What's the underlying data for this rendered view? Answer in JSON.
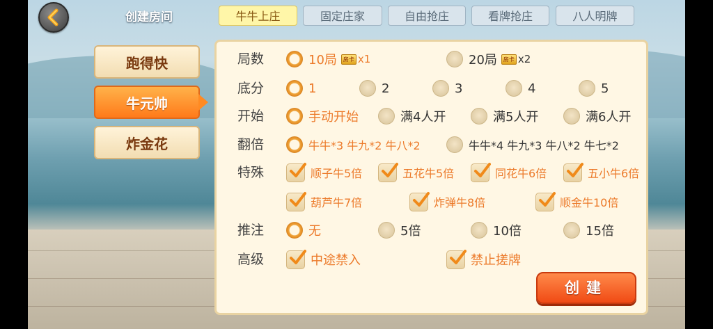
{
  "header": {
    "title": "创建房间",
    "tabs": [
      {
        "label": "牛牛上庄",
        "active": true
      },
      {
        "label": "固定庄家",
        "active": false
      },
      {
        "label": "自由抢庄",
        "active": false
      },
      {
        "label": "看牌抢庄",
        "active": false
      },
      {
        "label": "八人明牌",
        "active": false
      }
    ]
  },
  "sidebar": {
    "items": [
      {
        "label": "跑得快",
        "active": false
      },
      {
        "label": "牛元帅",
        "active": true
      },
      {
        "label": "炸金花",
        "active": false
      }
    ]
  },
  "settings": {
    "rounds": {
      "label": "局数",
      "options": [
        {
          "text": "10局",
          "card": "房卡",
          "mult": "x1",
          "selected": true
        },
        {
          "text": "20局",
          "card": "房卡",
          "mult": "x2",
          "selected": false
        }
      ]
    },
    "base": {
      "label": "底分",
      "options": [
        {
          "text": "1",
          "selected": true
        },
        {
          "text": "2",
          "selected": false
        },
        {
          "text": "3",
          "selected": false
        },
        {
          "text": "4",
          "selected": false
        },
        {
          "text": "5",
          "selected": false
        }
      ]
    },
    "start": {
      "label": "开始",
      "options": [
        {
          "text": "手动开始",
          "selected": true
        },
        {
          "text": "满4人开",
          "selected": false
        },
        {
          "text": "满5人开",
          "selected": false
        },
        {
          "text": "满6人开",
          "selected": false
        }
      ]
    },
    "double": {
      "label": "翻倍",
      "options": [
        {
          "text": "牛牛*3 牛九*2 牛八*2",
          "selected": true
        },
        {
          "text": "牛牛*4 牛九*3 牛八*2 牛七*2",
          "selected": false
        }
      ]
    },
    "special": {
      "label": "特殊",
      "options": [
        {
          "text": "顺子牛5倍",
          "checked": true
        },
        {
          "text": "五花牛5倍",
          "checked": true
        },
        {
          "text": "同花牛6倍",
          "checked": true
        },
        {
          "text": "五小牛6倍",
          "checked": true
        },
        {
          "text": "葫芦牛7倍",
          "checked": true
        },
        {
          "text": "炸弹牛8倍",
          "checked": true
        },
        {
          "text": "顺金牛10倍",
          "checked": true
        }
      ]
    },
    "bet": {
      "label": "推注",
      "options": [
        {
          "text": "无",
          "selected": true
        },
        {
          "text": "5倍",
          "selected": false
        },
        {
          "text": "10倍",
          "selected": false
        },
        {
          "text": "15倍",
          "selected": false
        }
      ]
    },
    "advanced": {
      "label": "高级",
      "options": [
        {
          "text": "中途禁入",
          "checked": true
        },
        {
          "text": "禁止搓牌",
          "checked": true
        }
      ]
    }
  },
  "create_label": "创建",
  "colors": {
    "accent": "#ec7a2a",
    "panel": "#fff7e4",
    "button": "#f04a14"
  }
}
